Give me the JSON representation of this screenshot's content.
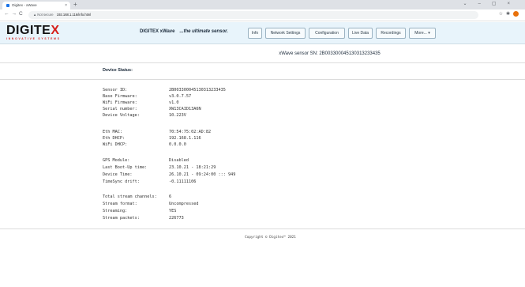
{
  "browser": {
    "tab_title": "Digitex - xWave",
    "tab_close": "×",
    "new_tab": "+",
    "window_controls": [
      "⌄",
      "–",
      "▢",
      "×"
    ],
    "nav_buttons": [
      "←",
      "→",
      "C"
    ],
    "security_label": "▲ Not secure",
    "url": "192.168.1.116/info.html",
    "addr_icons": [
      "☆",
      "✱"
    ]
  },
  "header": {
    "logo": "DIGITEX",
    "logo_sub": "INNOVATIVE SYSTEMS",
    "product": "DIGITEX xWave",
    "slogan": "...the ultimate sensor.",
    "nav": [
      "Info",
      "Network Settings",
      "Configuration",
      "Live Data",
      "Recordings",
      "More... ▾"
    ]
  },
  "sensor_title": "xWave sensor SN: 2B003300045130313233435",
  "section_title": "Device Status:",
  "groups": [
    [
      {
        "k": "Sensor ID:",
        "v": "2B003300045130313233435"
      },
      {
        "k": "Base Firmware:",
        "v": "v3.0.7.57"
      },
      {
        "k": "WiFi Firmware:",
        "v": "v1.0"
      },
      {
        "k": "Serial number:",
        "v": "XW13CAID13A6N"
      },
      {
        "k": "Device Voltage:",
        "v": "10.223V"
      }
    ],
    [
      {
        "k": "Eth MAC:",
        "v": "70:54:75:02:AD:82"
      },
      {
        "k": "Eth DHCP:",
        "v": "192.168.1.116"
      },
      {
        "k": "WiFi DHCP:",
        "v": "0.0.0.0"
      }
    ],
    [
      {
        "k": "GPS Module:",
        "v": "Disabled"
      },
      {
        "k": "Last Boot-Up time:",
        "v": "23.10.21 - 18:21:29"
      },
      {
        "k": "Device Time:",
        "v": "26.10.21 - 09:24:00 ::: 949"
      },
      {
        "k": "TimeSync drift:",
        "v": "-0.11111106"
      }
    ],
    [
      {
        "k": "Total stream channels:",
        "v": "6"
      },
      {
        "k": "Stream format:",
        "v": "Uncompressed"
      },
      {
        "k": "Streaming:",
        "v": "YES"
      },
      {
        "k": "Stream packets:",
        "v": "226773"
      }
    ]
  ],
  "footer": "Copyright © Digitex™ 2021",
  "colors": {
    "accent": "#d6201b",
    "header_bg": "#e8f4fb"
  }
}
